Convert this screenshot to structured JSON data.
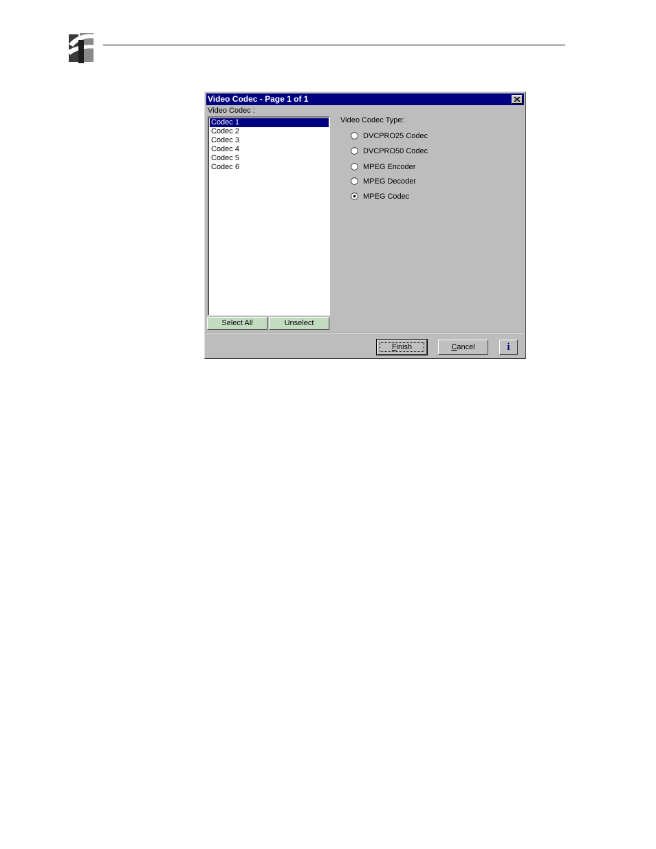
{
  "dialog": {
    "title": "Video Codec - Page 1 of 1",
    "list_caption": "Video Codec :",
    "codec_list": [
      {
        "label": "Codec 1",
        "selected": true
      },
      {
        "label": "Codec 2",
        "selected": false
      },
      {
        "label": "Codec 3",
        "selected": false
      },
      {
        "label": "Codec 4",
        "selected": false
      },
      {
        "label": "Codec 5",
        "selected": false
      },
      {
        "label": "Codec 6",
        "selected": false
      }
    ],
    "select_all_label": "Select All",
    "unselect_label": "Unselect",
    "type_caption": "Video Codec Type:",
    "codec_types": [
      {
        "label": "DVCPRO25 Codec",
        "checked": false
      },
      {
        "label": "DVCPRO50 Codec",
        "checked": false
      },
      {
        "label": "MPEG Encoder",
        "checked": false
      },
      {
        "label": "MPEG Decoder",
        "checked": false
      },
      {
        "label": "MPEG Codec",
        "checked": true
      }
    ],
    "finish_first": "F",
    "finish_rest": "inish",
    "cancel_first": "C",
    "cancel_rest": "ancel",
    "info_label": "i"
  },
  "colors": {
    "titlebar": "#000080",
    "dialog_bg": "#bdbdbd",
    "green_button": "#c1dcc1",
    "selection": "#000080"
  },
  "icons": [
    "company-logo-icon",
    "close-icon",
    "info-icon"
  ]
}
